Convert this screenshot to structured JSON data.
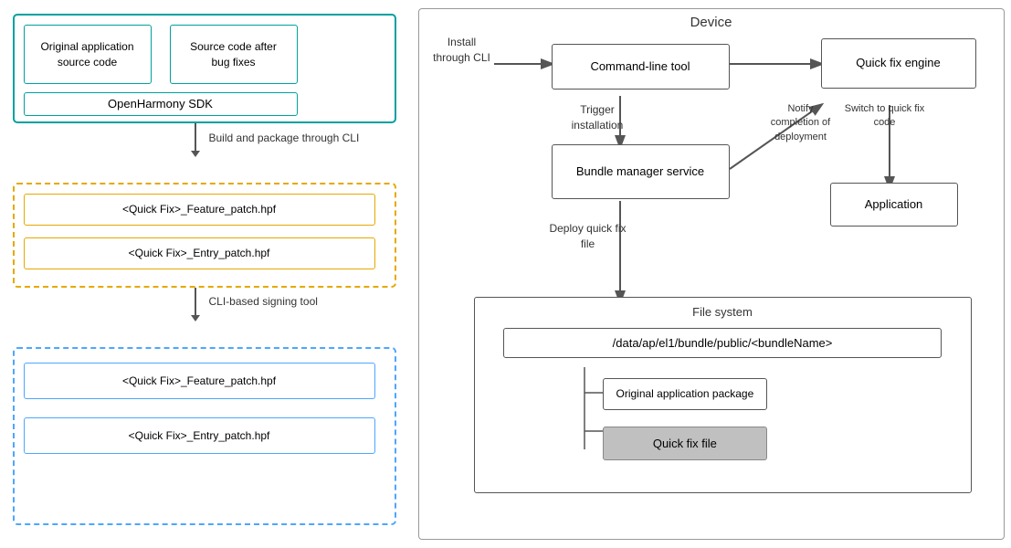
{
  "diagram": {
    "device_label": "Device",
    "left": {
      "original_source": "Original application\nsource code",
      "source_after_fixes": "Source code after\nbug fixes",
      "sdk_label": "OpenHarmony SDK",
      "build_label": "Build and package\nthrough CLI",
      "signing_label": "CLI-based signing tool",
      "feature_patch_1": "<Quick Fix>_Feature_patch.hpf",
      "entry_patch_1": "<Quick Fix>_Entry_patch.hpf",
      "feature_patch_2": "<Quick Fix>_Feature_patch.hpf",
      "entry_patch_2": "<Quick Fix>_Entry_patch.hpf"
    },
    "right": {
      "install_label": "Install\nthrough CLI",
      "cmd_tool": "Command-line tool",
      "quick_fix_engine": "Quick fix engine",
      "trigger_label": "Trigger\ninstallation",
      "bundle_manager": "Bundle manager\nservice",
      "notify_label": "Notify\ncompletion of\ndeployment",
      "switch_label": "Switch to quick\nfix code",
      "application_label": "Application",
      "deploy_label": "Deploy quick fix\nfile",
      "filesystem_label": "File system",
      "path_label": "/data/ap/el1/bundle/public/<bundleName>",
      "orig_pkg_label": "Original application\npackage",
      "quick_fix_file_label": "Quick fix file"
    }
  }
}
